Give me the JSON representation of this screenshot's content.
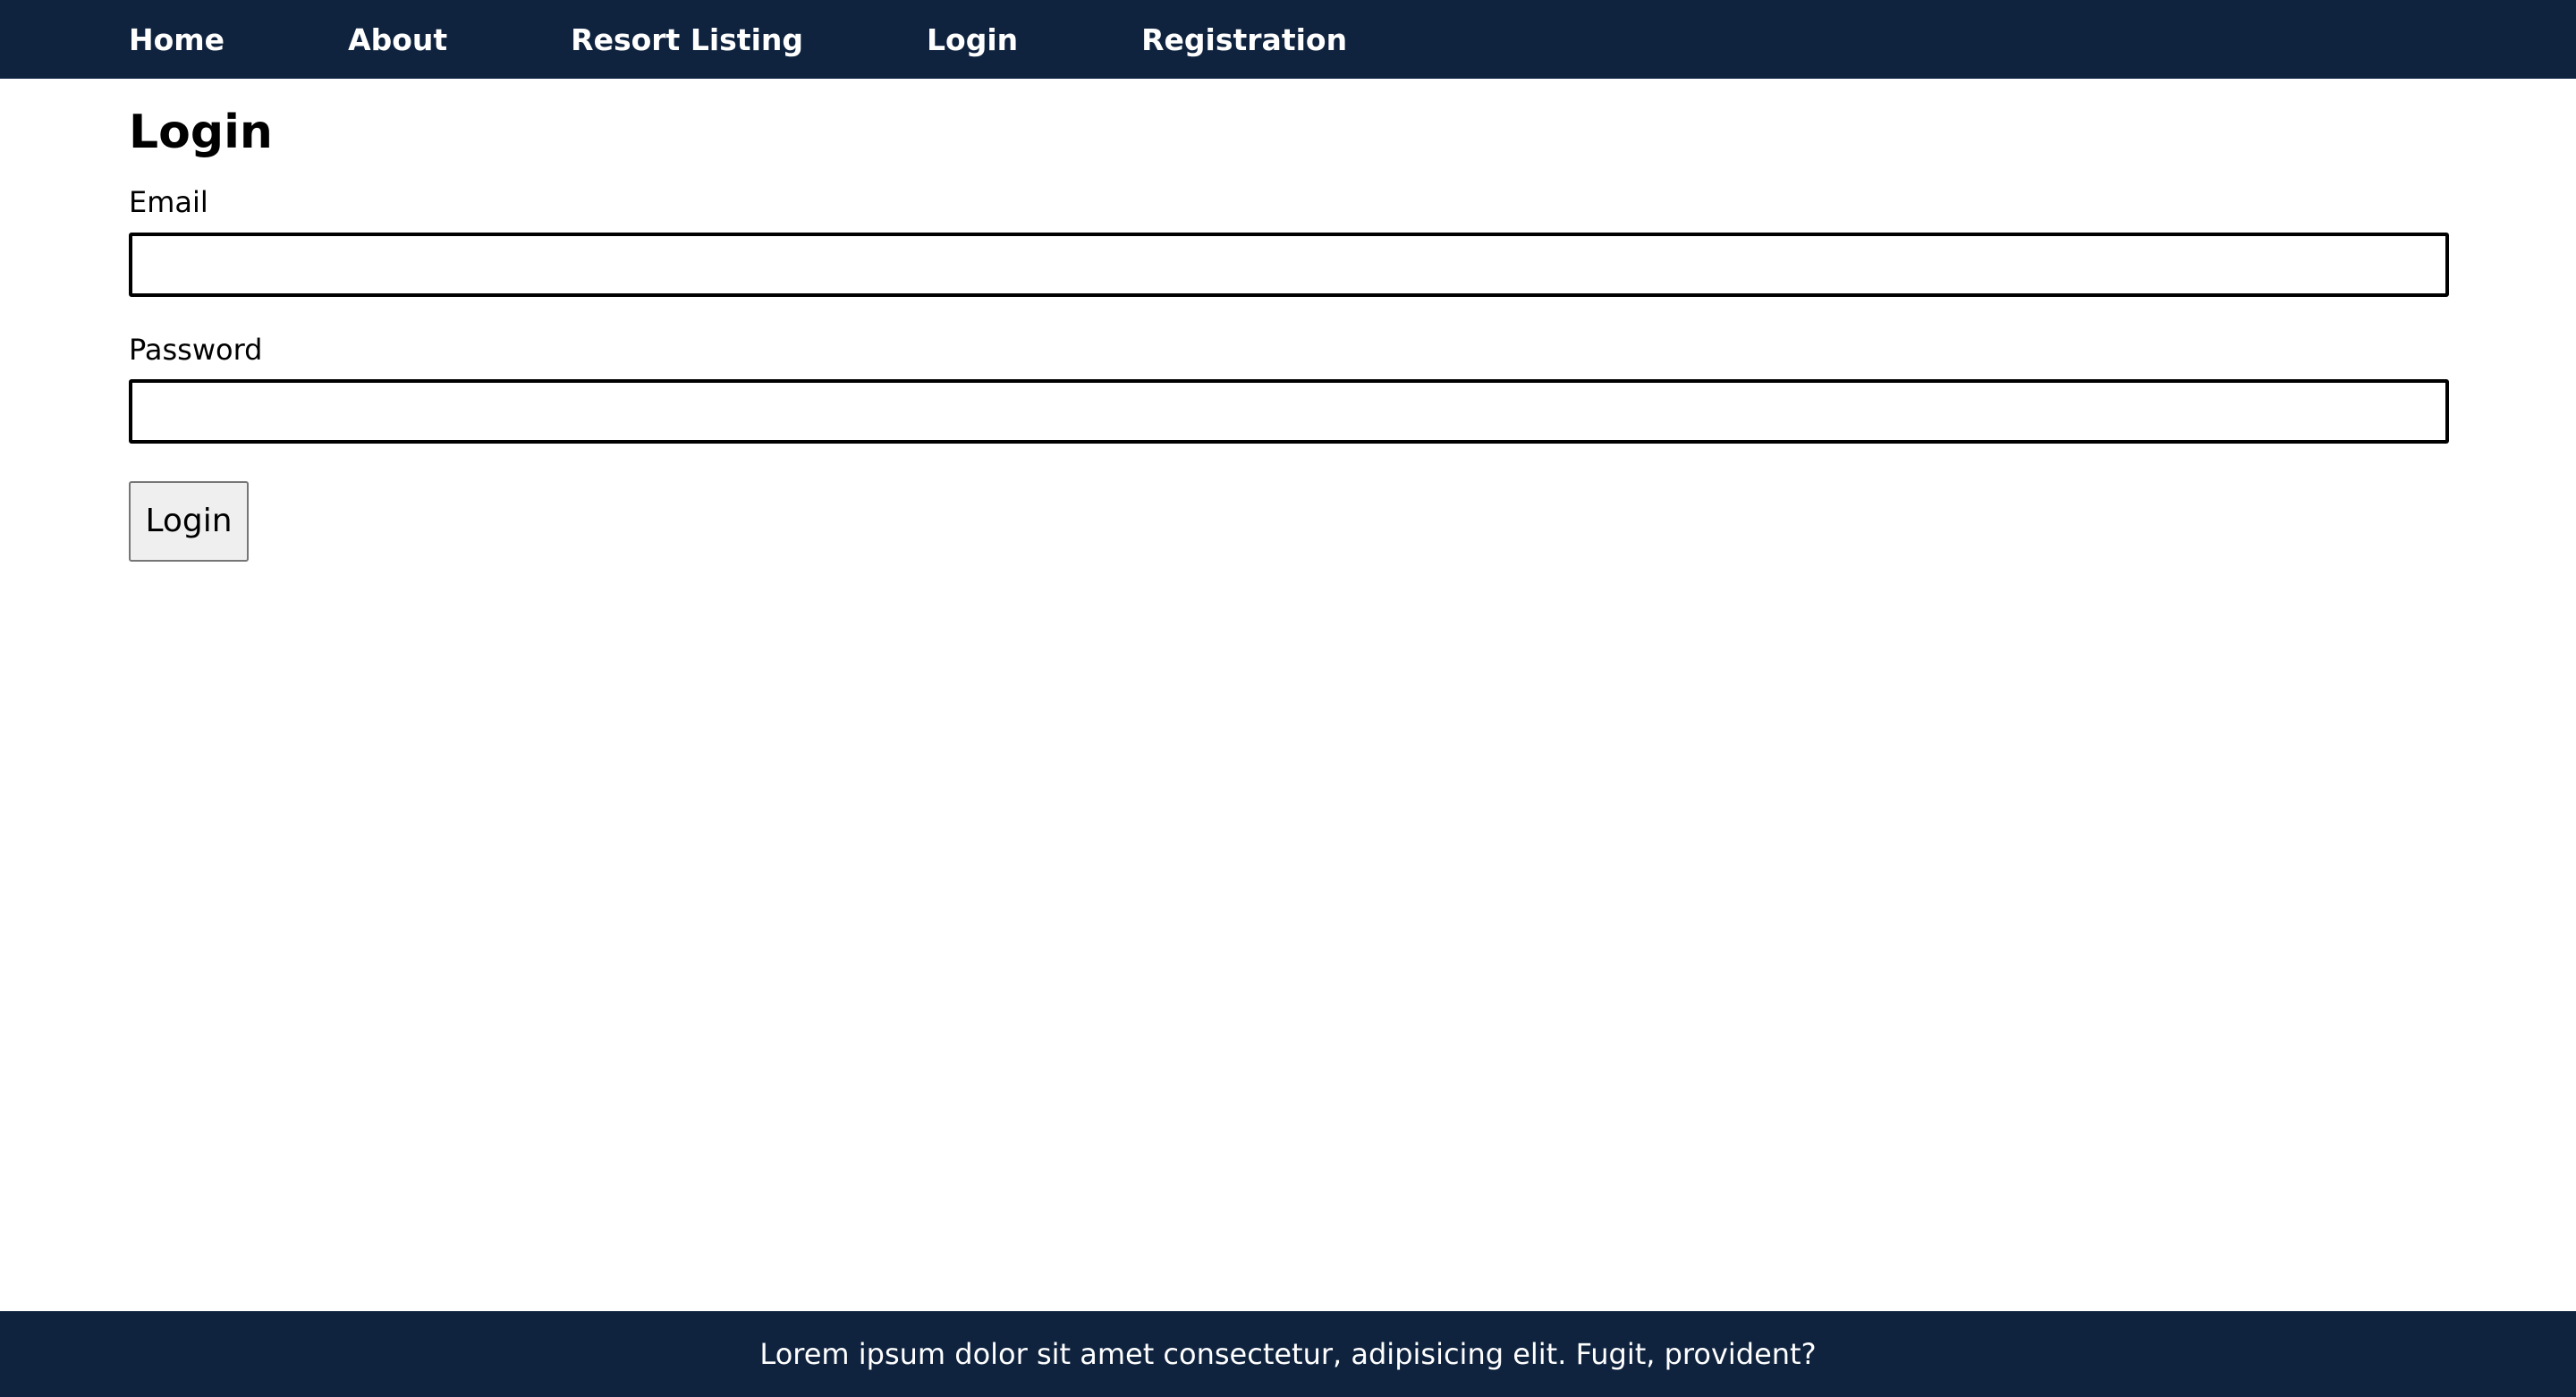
{
  "nav": {
    "items": [
      {
        "label": "Home"
      },
      {
        "label": "About"
      },
      {
        "label": "Resort Listing"
      },
      {
        "label": "Login"
      },
      {
        "label": "Registration"
      }
    ]
  },
  "main": {
    "title": "Login",
    "email": {
      "label": "Email",
      "value": "",
      "placeholder": ""
    },
    "password": {
      "label": "Password",
      "value": "",
      "placeholder": ""
    },
    "submit_label": "Login"
  },
  "footer": {
    "text": "Lorem ipsum dolor sit amet consectetur, adipisicing elit. Fugit, provident?"
  },
  "colors": {
    "header_bg": "#0f233f",
    "footer_bg": "#0f233f",
    "text_light": "#ffffff",
    "page_bg": "#ffffff"
  }
}
